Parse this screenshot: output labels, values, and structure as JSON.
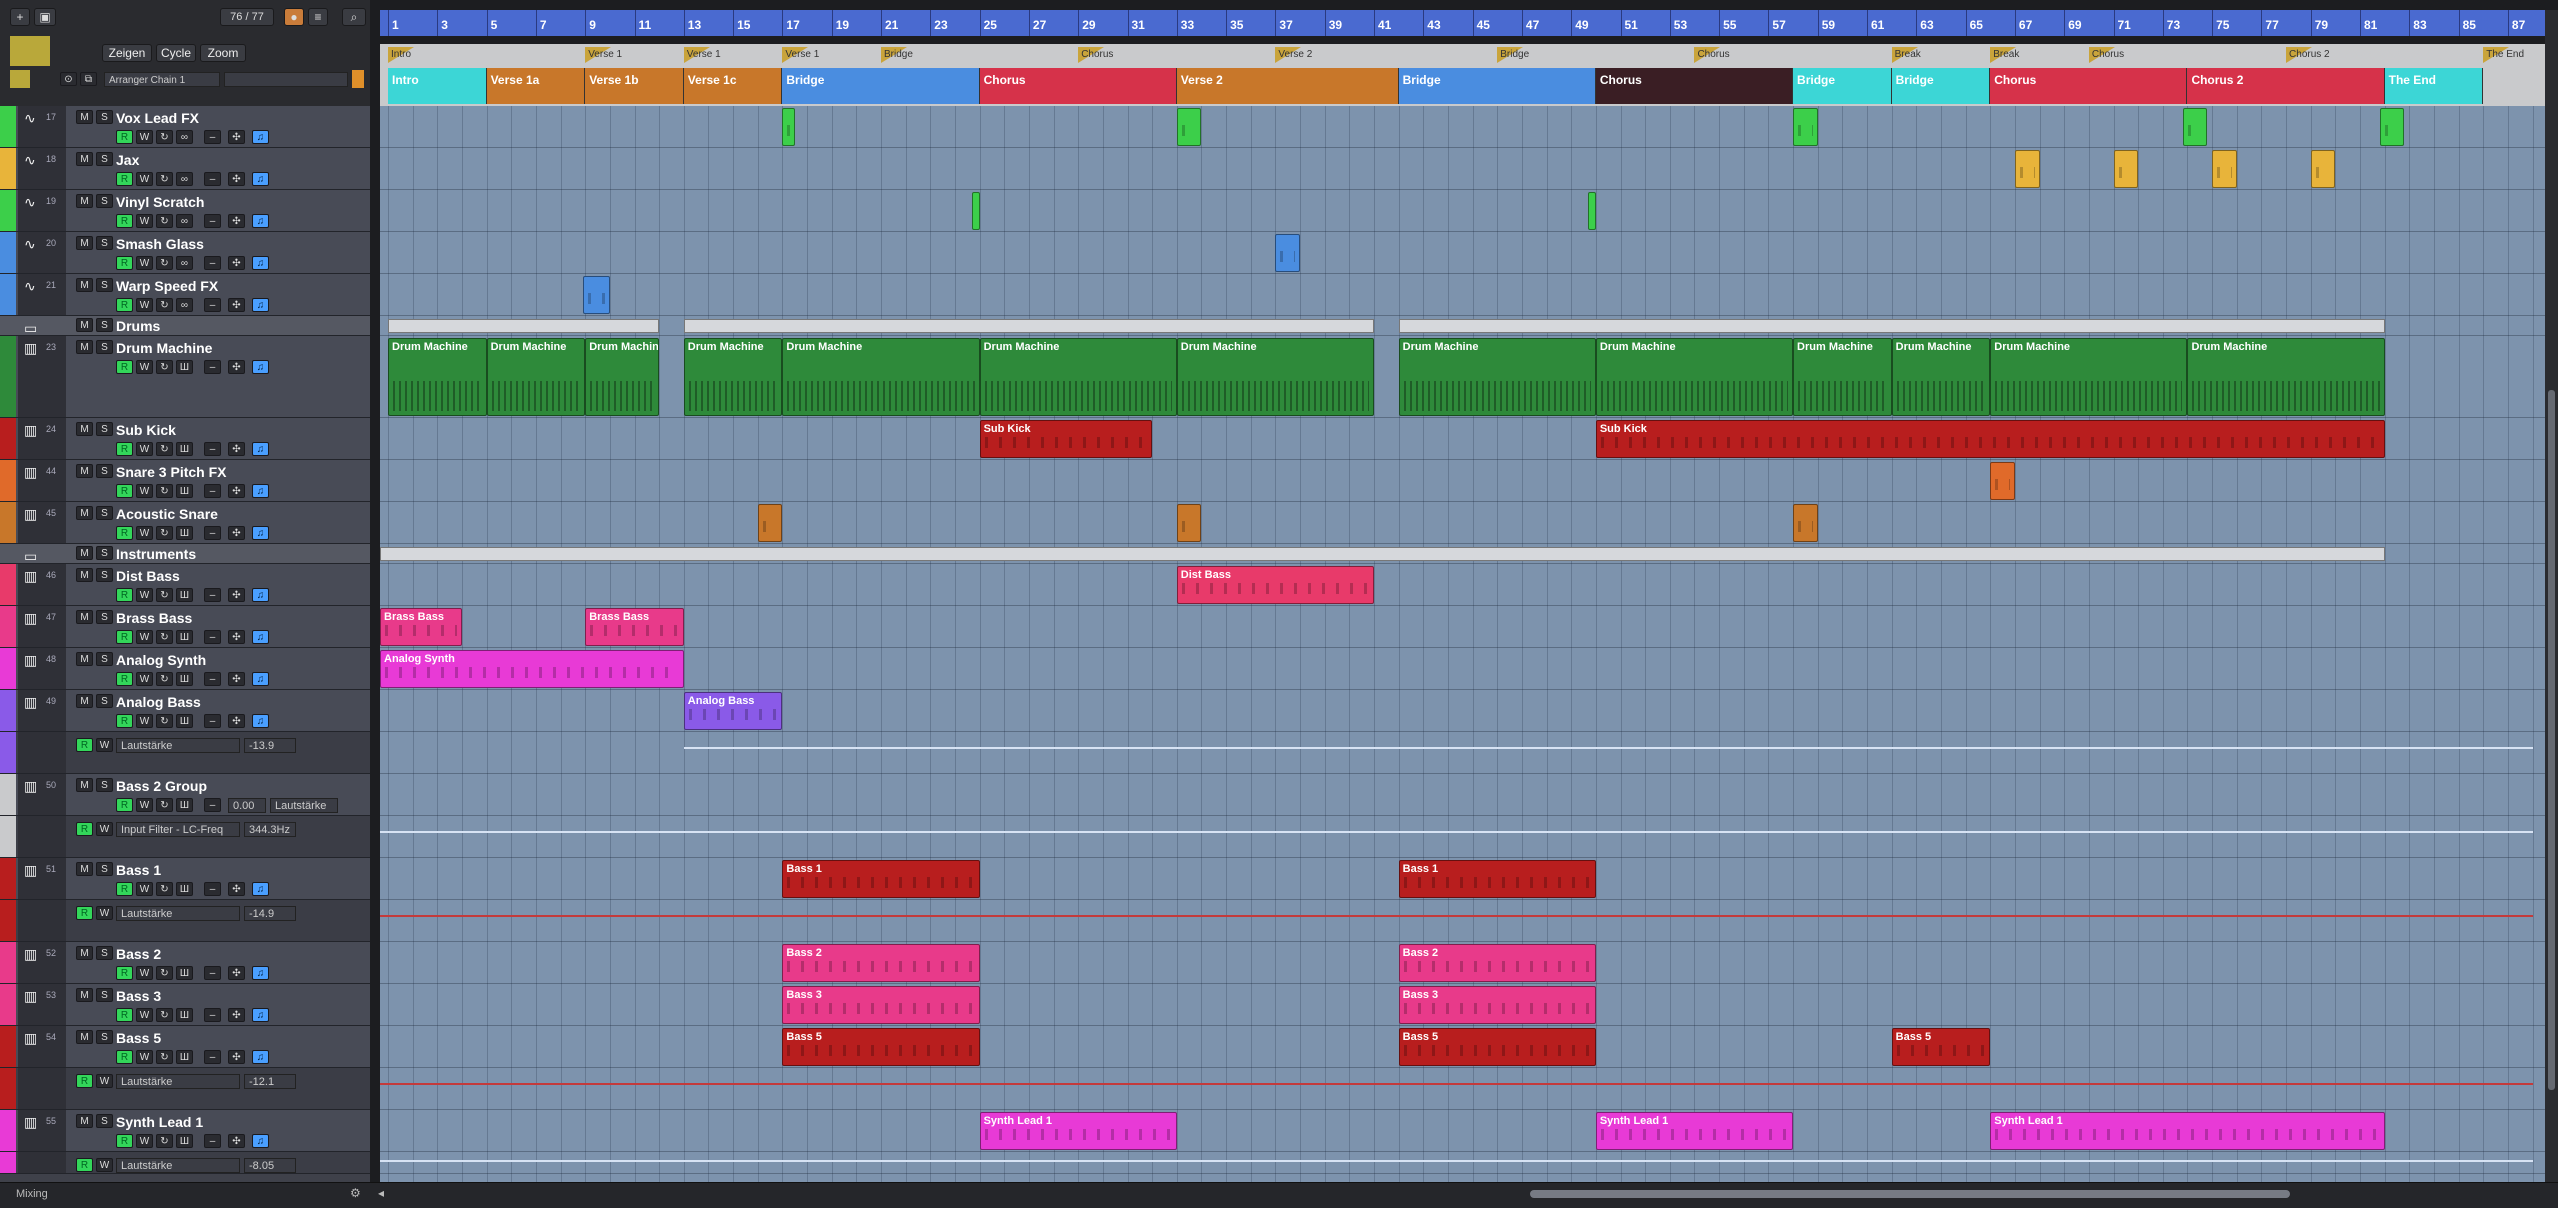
{
  "header": {
    "counter": "76 / 77",
    "buttons": {
      "show": "Zeigen",
      "cycle": "Cycle",
      "zoom": "Zoom"
    },
    "arranger_chain": "Arranger Chain 1"
  },
  "footer": {
    "label": "Mixing"
  },
  "ruler": {
    "bars": [
      "1",
      "3",
      "5",
      "7",
      "9",
      "11",
      "13",
      "15",
      "17",
      "19",
      "21",
      "23",
      "25",
      "27",
      "29",
      "31",
      "33",
      "35",
      "37",
      "39",
      "41",
      "43",
      "45",
      "47",
      "49",
      "51",
      "53",
      "55",
      "57",
      "59",
      "61",
      "63",
      "65",
      "67",
      "69",
      "71",
      "73",
      "75",
      "77",
      "79",
      "81",
      "83",
      "85",
      "87"
    ]
  },
  "markers": [
    {
      "label": "Intro",
      "bar": 1
    },
    {
      "label": "Verse 1",
      "bar": 9
    },
    {
      "label": "Verse 1",
      "bar": 13
    },
    {
      "label": "Verse 1",
      "bar": 17
    },
    {
      "label": "Bridge",
      "bar": 21
    },
    {
      "label": "Chorus",
      "bar": 29
    },
    {
      "label": "Verse 2",
      "bar": 37
    },
    {
      "label": "Bridge",
      "bar": 46
    },
    {
      "label": "Chorus",
      "bar": 54
    },
    {
      "label": "Break",
      "bar": 62
    },
    {
      "label": "Break",
      "bar": 66
    },
    {
      "label": "Chorus",
      "bar": 70
    },
    {
      "label": "Chorus 2",
      "bar": 78
    },
    {
      "label": "The End",
      "bar": 86
    }
  ],
  "sections": [
    {
      "label": "Intro",
      "start": 1,
      "end": 5,
      "color": "#3cd6d6"
    },
    {
      "label": "Verse 1a",
      "start": 5,
      "end": 9,
      "color": "#c8772a"
    },
    {
      "label": "Verse 1b",
      "start": 9,
      "end": 13,
      "color": "#c8772a"
    },
    {
      "label": "Verse 1c",
      "start": 13,
      "end": 17,
      "color": "#c8772a"
    },
    {
      "label": "Bridge",
      "start": 17,
      "end": 25,
      "color": "#4a8de0"
    },
    {
      "label": "Chorus",
      "start": 25,
      "end": 33,
      "color": "#d6324a"
    },
    {
      "label": "Verse 2",
      "start": 33,
      "end": 42,
      "color": "#c8772a"
    },
    {
      "label": "Bridge",
      "start": 42,
      "end": 50,
      "color": "#4a8de0"
    },
    {
      "label": "Chorus",
      "start": 50,
      "end": 58,
      "color": "#3a1e24"
    },
    {
      "label": "Bridge",
      "start": 58,
      "end": 62,
      "color": "#3cd6d6"
    },
    {
      "label": "Bridge",
      "start": 62,
      "end": 66,
      "color": "#3cd6d6"
    },
    {
      "label": "Chorus",
      "start": 66,
      "end": 74,
      "color": "#d6324a"
    },
    {
      "label": "Chorus 2",
      "start": 74,
      "end": 82,
      "color": "#d6324a"
    },
    {
      "label": "The End",
      "start": 82,
      "end": 86,
      "color": "#3cd6d6"
    }
  ],
  "tracks": [
    {
      "id": "t17",
      "num": "17",
      "name": "Vox Lead FX",
      "h": 42,
      "color": "#3ccf4a",
      "type": "audio"
    },
    {
      "id": "t18",
      "num": "18",
      "name": "Jax",
      "h": 42,
      "color": "#e8b43a",
      "type": "audio"
    },
    {
      "id": "t19",
      "num": "19",
      "name": "Vinyl Scratch",
      "h": 42,
      "color": "#3ccf4a",
      "type": "audio"
    },
    {
      "id": "t20",
      "num": "20",
      "name": "Smash Glass",
      "h": 42,
      "color": "#4a8de0",
      "type": "audio"
    },
    {
      "id": "t21",
      "num": "21",
      "name": "Warp Speed FX",
      "h": 42,
      "color": "#4a8de0",
      "type": "audio"
    },
    {
      "id": "tf1",
      "num": "",
      "name": "Drums",
      "h": 20,
      "color": "#555862",
      "type": "folder"
    },
    {
      "id": "t23",
      "num": "23",
      "name": "Drum Machine",
      "h": 82,
      "color": "#2e8a3a",
      "type": "inst"
    },
    {
      "id": "t24",
      "num": "24",
      "name": "Sub Kick",
      "h": 42,
      "color": "#b81e1e",
      "type": "inst"
    },
    {
      "id": "t44",
      "num": "44",
      "name": "Snare 3 Pitch FX",
      "h": 42,
      "color": "#e06a2a",
      "type": "inst"
    },
    {
      "id": "t45",
      "num": "45",
      "name": "Acoustic Snare",
      "h": 42,
      "color": "#c8772a",
      "type": "inst"
    },
    {
      "id": "tf2",
      "num": "",
      "name": "Instruments",
      "h": 20,
      "color": "#555862",
      "type": "folder"
    },
    {
      "id": "t46",
      "num": "46",
      "name": "Dist Bass",
      "h": 42,
      "color": "#e83a6a",
      "type": "inst"
    },
    {
      "id": "t47",
      "num": "47",
      "name": "Brass Bass",
      "h": 42,
      "color": "#e83a8a",
      "type": "inst"
    },
    {
      "id": "t48",
      "num": "48",
      "name": "Analog Synth",
      "h": 42,
      "color": "#e83ad6",
      "type": "inst"
    },
    {
      "id": "t49",
      "num": "49",
      "name": "Analog Bass",
      "h": 42,
      "color": "#8a5ae8",
      "type": "inst"
    },
    {
      "id": "a49",
      "num": "",
      "name": "",
      "h": 42,
      "color": "#8a5ae8",
      "type": "auto",
      "param": "Lautstärke",
      "value": "-13.9"
    },
    {
      "id": "t50",
      "num": "50",
      "name": "Bass 2 Group",
      "h": 42,
      "color": "#c9cacc",
      "type": "group",
      "value": "0.00",
      "param": "Lautstärke"
    },
    {
      "id": "a50",
      "num": "",
      "name": "",
      "h": 42,
      "color": "#c9cacc",
      "type": "auto",
      "param": "Input Filter - LC-Freq",
      "value": "344.3Hz"
    },
    {
      "id": "t51",
      "num": "51",
      "name": "Bass 1",
      "h": 42,
      "color": "#b81e1e",
      "type": "inst"
    },
    {
      "id": "a51",
      "num": "",
      "name": "",
      "h": 42,
      "color": "#b81e1e",
      "type": "auto",
      "param": "Lautstärke",
      "value": "-14.9"
    },
    {
      "id": "t52",
      "num": "52",
      "name": "Bass 2",
      "h": 42,
      "color": "#e83a8a",
      "type": "inst"
    },
    {
      "id": "t53",
      "num": "53",
      "name": "Bass 3",
      "h": 42,
      "color": "#e83a8a",
      "type": "inst"
    },
    {
      "id": "t54",
      "num": "54",
      "name": "Bass 5",
      "h": 42,
      "color": "#b81e1e",
      "type": "inst"
    },
    {
      "id": "a54",
      "num": "",
      "name": "",
      "h": 42,
      "color": "#b81e1e",
      "type": "auto",
      "param": "Lautstärke",
      "value": "-12.1"
    },
    {
      "id": "t55",
      "num": "55",
      "name": "Synth Lead 1",
      "h": 42,
      "color": "#e83ad6",
      "type": "inst"
    },
    {
      "id": "a55",
      "num": "",
      "name": "",
      "h": 22,
      "color": "#e83ad6",
      "type": "auto2",
      "param": "Lautstärke",
      "value": "-8.05"
    }
  ],
  "events": [
    {
      "track": "t17",
      "start": 17,
      "end": 17.5,
      "label": "",
      "color": "#3ccf4a"
    },
    {
      "track": "t17",
      "start": 33,
      "end": 34,
      "label": "",
      "color": "#3ccf4a"
    },
    {
      "track": "t17",
      "start": 58,
      "end": 59,
      "label": "",
      "color": "#3ccf4a"
    },
    {
      "track": "t17",
      "start": 73.8,
      "end": 74.8,
      "label": "",
      "color": "#3ccf4a"
    },
    {
      "track": "t17",
      "start": 81.8,
      "end": 82.8,
      "label": "",
      "color": "#3ccf4a"
    },
    {
      "track": "t18",
      "start": 67,
      "end": 68,
      "label": "",
      "color": "#e8b43a"
    },
    {
      "track": "t18",
      "start": 71,
      "end": 72,
      "label": "",
      "color": "#e8b43a"
    },
    {
      "track": "t18",
      "start": 75,
      "end": 76,
      "label": "",
      "color": "#e8b43a"
    },
    {
      "track": "t18",
      "start": 79,
      "end": 80,
      "label": "",
      "color": "#e8b43a"
    },
    {
      "track": "t19",
      "start": 24.7,
      "end": 25,
      "label": "",
      "color": "#3ccf4a"
    },
    {
      "track": "t19",
      "start": 49.7,
      "end": 50,
      "label": "",
      "color": "#3ccf4a"
    },
    {
      "track": "t20",
      "start": 37,
      "end": 38,
      "label": "",
      "color": "#4a8de0"
    },
    {
      "track": "t21",
      "start": 8.9,
      "end": 10,
      "label": "",
      "color": "#4a8de0"
    },
    {
      "track": "t23",
      "start": 1,
      "end": 5,
      "label": "Drum Machine",
      "color": "#2e8a3a"
    },
    {
      "track": "t23",
      "start": 5,
      "end": 9,
      "label": "Drum Machine",
      "color": "#2e8a3a"
    },
    {
      "track": "t23",
      "start": 9,
      "end": 12,
      "label": "Drum Machine",
      "color": "#2e8a3a"
    },
    {
      "track": "t23",
      "start": 13,
      "end": 17,
      "label": "Drum Machine",
      "color": "#2e8a3a"
    },
    {
      "track": "t23",
      "start": 17,
      "end": 25,
      "label": "Drum Machine",
      "color": "#2e8a3a"
    },
    {
      "track": "t23",
      "start": 25,
      "end": 33,
      "label": "Drum Machine",
      "color": "#2e8a3a"
    },
    {
      "track": "t23",
      "start": 33,
      "end": 41,
      "label": "Drum Machine",
      "color": "#2e8a3a"
    },
    {
      "track": "t23",
      "start": 42,
      "end": 50,
      "label": "Drum Machine",
      "color": "#2e8a3a"
    },
    {
      "track": "t23",
      "start": 50,
      "end": 58,
      "label": "Drum Machine",
      "color": "#2e8a3a"
    },
    {
      "track": "t23",
      "start": 58,
      "end": 62,
      "label": "Drum Machine",
      "color": "#2e8a3a"
    },
    {
      "track": "t23",
      "start": 62,
      "end": 66,
      "label": "Drum Machine",
      "color": "#2e8a3a"
    },
    {
      "track": "t23",
      "start": 66,
      "end": 74,
      "label": "Drum Machine",
      "color": "#2e8a3a"
    },
    {
      "track": "t23",
      "start": 74,
      "end": 82,
      "label": "Drum Machine",
      "color": "#2e8a3a"
    },
    {
      "track": "t24",
      "start": 25,
      "end": 32,
      "label": "Sub Kick",
      "color": "#b81e1e"
    },
    {
      "track": "t24",
      "start": 50,
      "end": 82,
      "label": "Sub Kick",
      "color": "#b81e1e"
    },
    {
      "track": "t44",
      "start": 66,
      "end": 67,
      "label": "",
      "color": "#e06a2a"
    },
    {
      "track": "t45",
      "start": 16,
      "end": 17,
      "label": "",
      "color": "#c8772a"
    },
    {
      "track": "t45",
      "start": 33,
      "end": 34,
      "label": "",
      "color": "#c8772a"
    },
    {
      "track": "t45",
      "start": 58,
      "end": 59,
      "label": "",
      "color": "#c8772a"
    },
    {
      "track": "t46",
      "start": 33,
      "end": 41,
      "label": "Dist Bass",
      "color": "#e83a6a"
    },
    {
      "track": "t47",
      "start": 0,
      "end": 4,
      "label": "Brass Bass",
      "color": "#e83a8a"
    },
    {
      "track": "t47",
      "start": 9,
      "end": 13,
      "label": "Brass Bass",
      "color": "#e83a8a"
    },
    {
      "track": "t48",
      "start": 0,
      "end": 13,
      "label": "Analog Synth",
      "color": "#e83ad6"
    },
    {
      "track": "t49",
      "start": 13,
      "end": 17,
      "label": "Analog Bass",
      "color": "#8a5ae8"
    },
    {
      "track": "t51",
      "start": 17,
      "end": 25,
      "label": "Bass 1",
      "color": "#b81e1e"
    },
    {
      "track": "t51",
      "start": 42,
      "end": 50,
      "label": "Bass 1",
      "color": "#b81e1e"
    },
    {
      "track": "t52",
      "start": 17,
      "end": 25,
      "label": "Bass 2",
      "color": "#e83a8a"
    },
    {
      "track": "t52",
      "start": 42,
      "end": 50,
      "label": "Bass 2",
      "color": "#e83a8a"
    },
    {
      "track": "t53",
      "start": 17,
      "end": 25,
      "label": "Bass 3",
      "color": "#e83a8a"
    },
    {
      "track": "t53",
      "start": 42,
      "end": 50,
      "label": "Bass 3",
      "color": "#e83a8a"
    },
    {
      "track": "t54",
      "start": 17,
      "end": 25,
      "label": "Bass 5",
      "color": "#b81e1e"
    },
    {
      "track": "t54",
      "start": 42,
      "end": 50,
      "label": "Bass 5",
      "color": "#b81e1e"
    },
    {
      "track": "t54",
      "start": 62,
      "end": 66,
      "label": "Bass 5",
      "color": "#b81e1e"
    },
    {
      "track": "t55",
      "start": 25,
      "end": 33,
      "label": "Synth Lead 1",
      "color": "#e83ad6"
    },
    {
      "track": "t55",
      "start": 50,
      "end": 58,
      "label": "Synth Lead 1",
      "color": "#e83ad6"
    },
    {
      "track": "t55",
      "start": 66,
      "end": 82,
      "label": "Synth Lead 1",
      "color": "#e83ad6"
    }
  ],
  "folder_parts": [
    {
      "track": "tf1",
      "start": 1,
      "end": 12
    },
    {
      "track": "tf1",
      "start": 13,
      "end": 41
    },
    {
      "track": "tf1",
      "start": 42,
      "end": 82
    },
    {
      "track": "tf2",
      "start": 0,
      "end": 82
    }
  ]
}
